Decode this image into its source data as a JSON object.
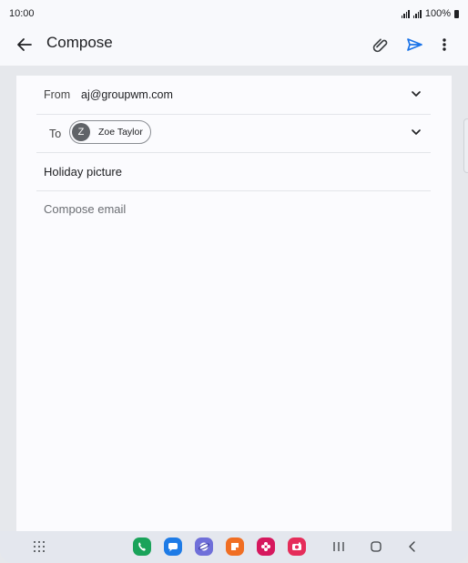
{
  "status_bar": {
    "time": "10:00",
    "battery": "100%"
  },
  "app_bar": {
    "title": "Compose"
  },
  "compose": {
    "from_label": "From",
    "from_value": "aj@groupwm.com",
    "to_label": "To",
    "recipient": {
      "initial": "Z",
      "name": "Zoe Taylor"
    },
    "subject": "Holiday picture",
    "body_placeholder": "Compose email"
  },
  "colors": {
    "accent": "#1a73e8",
    "phone": "#1aa35a",
    "messages": "#1e7be6",
    "samsung_internet": "#6f6fd9",
    "orange_app": "#f06e23",
    "blossom_app": "#d6185e",
    "camera": "#e52d5a"
  },
  "dock": {
    "icons": [
      "apps-grid-icon",
      "phone-icon",
      "messages-icon",
      "internet-icon",
      "notes-icon",
      "gallery-icon",
      "camera-icon"
    ]
  }
}
